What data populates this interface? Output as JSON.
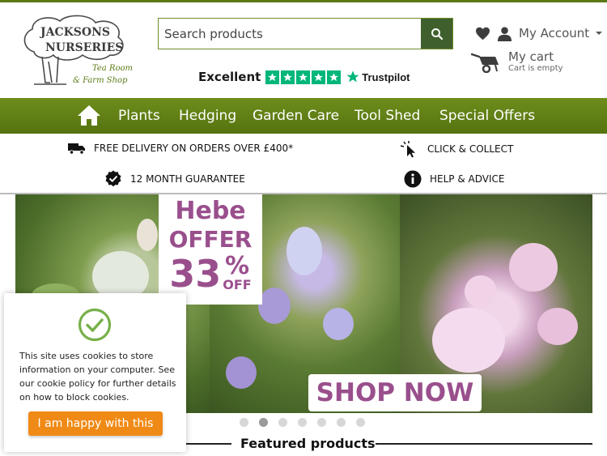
{
  "brand": {
    "logo_line1": "JACKSONS",
    "logo_line2": "NURSERIES",
    "logo_line3": "Tea Room",
    "logo_line4": "& Farm Shop"
  },
  "search": {
    "placeholder": "Search products"
  },
  "trustpilot": {
    "rating_word": "Excellent",
    "stars": 5,
    "brand": "Trustpilot"
  },
  "account": {
    "label": "My Account"
  },
  "cart": {
    "title": "My cart",
    "status": "Cart is empty"
  },
  "nav": {
    "items": [
      {
        "label": "Plants"
      },
      {
        "label": "Hedging"
      },
      {
        "label": "Garden Care"
      },
      {
        "label": "Tool Shed"
      },
      {
        "label": "Special Offers"
      }
    ]
  },
  "usp": {
    "delivery": "FREE DELIVERY ON ORDERS OVER £400*",
    "collect": "CLICK & COLLECT",
    "guarantee": "12 MONTH GUARANTEE",
    "help": "HELP & ADVICE"
  },
  "banner": {
    "line1": "Hebe",
    "line2": "OFFER",
    "percent_number": "33",
    "percent_symbol": "%",
    "percent_off": "OFF",
    "cta": "SHOP NOW"
  },
  "carousel": {
    "slide_count": 7,
    "active_index": 1
  },
  "featured": {
    "title": "Featured products"
  },
  "cookie": {
    "message": "This site uses cookies to store information on your computer. See our cookie policy for further details on how to block cookies.",
    "accept_label": "I am happy with this"
  },
  "colors": {
    "brand_green": "#5b7a16",
    "search_button": "#3f5f2c",
    "trustpilot_green": "#00b67a",
    "offer_purple": "#9a4f8d",
    "cookie_orange": "#f08a16"
  }
}
